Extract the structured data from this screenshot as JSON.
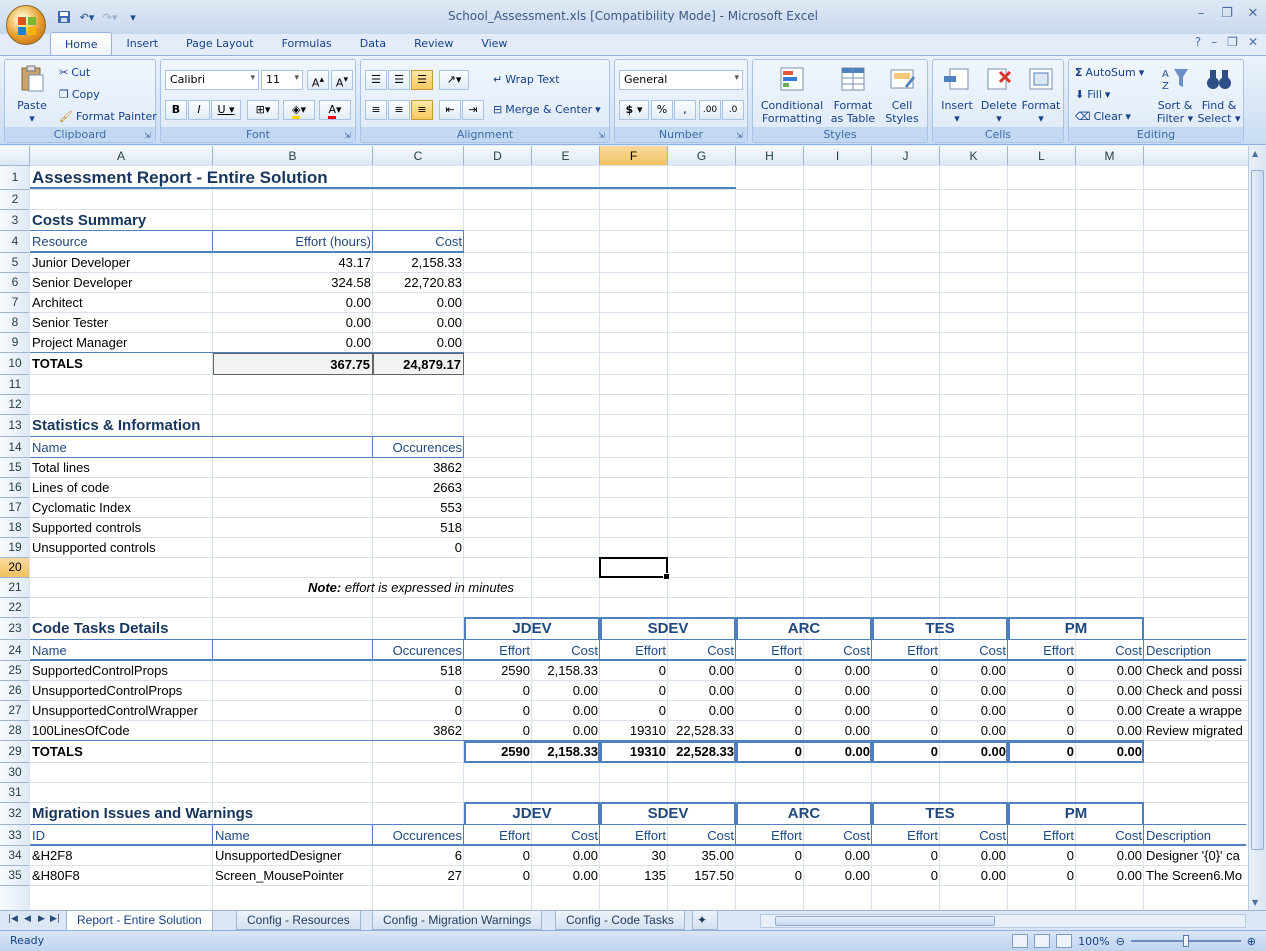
{
  "window": {
    "title": "School_Assessment.xls  [Compatibility Mode] - Microsoft Excel"
  },
  "ribbon_tabs": [
    "Home",
    "Insert",
    "Page Layout",
    "Formulas",
    "Data",
    "Review",
    "View"
  ],
  "ribbon": {
    "clipboard": {
      "paste": "Paste",
      "cut": "Cut",
      "copy": "Copy",
      "format_painter": "Format Painter",
      "label": "Clipboard"
    },
    "font": {
      "name": "Calibri",
      "size": "11",
      "label": "Font"
    },
    "alignment": {
      "wrap": "Wrap Text",
      "merge": "Merge & Center",
      "label": "Alignment"
    },
    "number": {
      "format": "General",
      "label": "Number"
    },
    "styles": {
      "conditional": "Conditional",
      "conditional2": "Formatting",
      "format_table": "Format",
      "format_table2": "as Table",
      "cell_styles": "Cell",
      "cell_styles2": "Styles",
      "label": "Styles"
    },
    "cells": {
      "insert": "Insert",
      "delete": "Delete",
      "format": "Format",
      "label": "Cells"
    },
    "editing": {
      "autosum": "AutoSum",
      "fill": "Fill",
      "clear": "Clear",
      "sort": "Sort &",
      "sort2": "Filter",
      "find": "Find &",
      "find2": "Select",
      "label": "Editing"
    }
  },
  "columns": [
    "A",
    "B",
    "C",
    "D",
    "E",
    "F",
    "G",
    "H",
    "I",
    "J",
    "K",
    "L",
    "M"
  ],
  "rows": [
    "1",
    "2",
    "3",
    "4",
    "5",
    "6",
    "7",
    "8",
    "9",
    "10",
    "11",
    "12",
    "13",
    "14",
    "15",
    "16",
    "17",
    "18",
    "19",
    "20",
    "21",
    "22",
    "23",
    "24",
    "25",
    "26",
    "27",
    "28",
    "29",
    "30",
    "31",
    "32",
    "33",
    "34",
    "35"
  ],
  "sheet": {
    "title": "Assessment Report - Entire Solution",
    "costs": {
      "heading": "Costs Summary",
      "col_resource": "Resource",
      "col_effort": "Effort (hours)",
      "col_cost": "Cost",
      "rows": [
        {
          "name": "Junior Developer",
          "effort": "43.17",
          "cost": "2,158.33"
        },
        {
          "name": "Senior Developer",
          "effort": "324.58",
          "cost": "22,720.83"
        },
        {
          "name": "Architect",
          "effort": "0.00",
          "cost": "0.00"
        },
        {
          "name": "Senior Tester",
          "effort": "0.00",
          "cost": "0.00"
        },
        {
          "name": "Project Manager",
          "effort": "0.00",
          "cost": "0.00"
        }
      ],
      "totals_label": "TOTALS",
      "total_effort": "367.75",
      "total_cost": "24,879.17"
    },
    "stats": {
      "heading": "Statistics & Information",
      "col_name": "Name",
      "col_occ": "Occurences",
      "rows": [
        {
          "name": "Total lines",
          "value": "3862"
        },
        {
          "name": "Lines of code",
          "value": "2663"
        },
        {
          "name": "Cyclomatic Index",
          "value": "553"
        },
        {
          "name": "Supported controls",
          "value": "518"
        },
        {
          "name": "Unsupported controls",
          "value": "0"
        }
      ]
    },
    "note": {
      "label": "Note:",
      "text": "effort is expressed in minutes"
    },
    "groups": [
      "JDEV",
      "SDEV",
      "ARC",
      "TES",
      "PM"
    ],
    "sub_effort": "Effort",
    "sub_cost": "Cost",
    "col_description": "Description",
    "code_tasks": {
      "heading": "Code Tasks Details",
      "col_name": "Name",
      "col_occ": "Occurences",
      "rows": [
        {
          "name": "SupportedControlProps",
          "occ": "518",
          "v": [
            "2590",
            "2,158.33",
            "0",
            "0.00",
            "0",
            "0.00",
            "0",
            "0.00",
            "0",
            "0.00"
          ],
          "desc": "Check and possi"
        },
        {
          "name": "UnsupportedControlProps",
          "occ": "0",
          "v": [
            "0",
            "0.00",
            "0",
            "0.00",
            "0",
            "0.00",
            "0",
            "0.00",
            "0",
            "0.00"
          ],
          "desc": "Check and possi"
        },
        {
          "name": "UnsupportedControlWrapper",
          "occ": "0",
          "v": [
            "0",
            "0.00",
            "0",
            "0.00",
            "0",
            "0.00",
            "0",
            "0.00",
            "0",
            "0.00"
          ],
          "desc": "Create a wrappe"
        },
        {
          "name": "100LinesOfCode",
          "occ": "3862",
          "v": [
            "0",
            "0.00",
            "19310",
            "22,528.33",
            "0",
            "0.00",
            "0",
            "0.00",
            "0",
            "0.00"
          ],
          "desc": "Review migrated"
        }
      ],
      "totals_label": "TOTALS",
      "totals": [
        "2590",
        "2,158.33",
        "19310",
        "22,528.33",
        "0",
        "0.00",
        "0",
        "0.00",
        "0",
        "0.00"
      ]
    },
    "migration": {
      "heading": "Migration Issues and Warnings",
      "col_id": "ID",
      "col_name": "Name",
      "col_occ": "Occurences",
      "rows": [
        {
          "id": "&H2F8",
          "name": "UnsupportedDesigner",
          "occ": "6",
          "v": [
            "0",
            "0.00",
            "30",
            "35.00",
            "0",
            "0.00",
            "0",
            "0.00",
            "0",
            "0.00"
          ],
          "desc": "Designer '{0}' ca"
        },
        {
          "id": "&H80F8",
          "name": "Screen_MousePointer",
          "occ": "27",
          "v": [
            "0",
            "0.00",
            "135",
            "157.50",
            "0",
            "0.00",
            "0",
            "0.00",
            "0",
            "0.00"
          ],
          "desc": "The Screen6.Mo"
        }
      ]
    }
  },
  "sheet_tabs": [
    "Report - Entire Solution",
    "Config - Resources",
    "Config - Migration Warnings",
    "Config - Code Tasks"
  ],
  "status": {
    "ready": "Ready",
    "zoom": "100%"
  }
}
